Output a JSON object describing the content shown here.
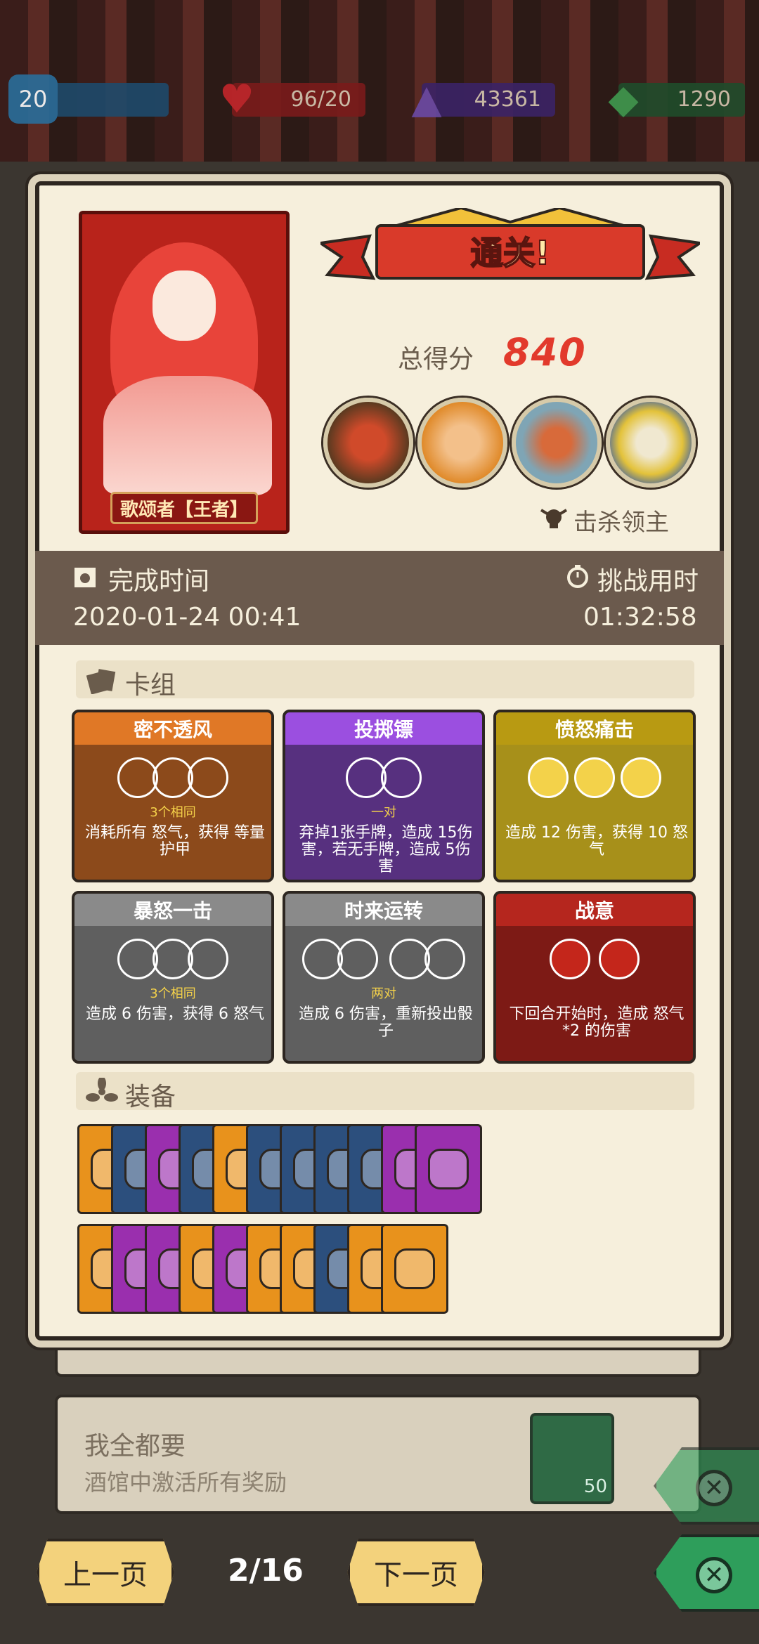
{
  "stats": {
    "level": "20",
    "hp": "96/20",
    "purple": "43361",
    "green": "1290"
  },
  "background_list": [
    {
      "title": "",
      "desc": "",
      "gem_count": "50"
    },
    {
      "title": "我全都要",
      "desc": "酒馆中激活所有奖励",
      "gem_count": "50"
    }
  ],
  "result": {
    "hero_name": "歌颂者【王者】",
    "banner": "通关!",
    "score_label": "总得分",
    "score_value": "840",
    "kill_label": "击杀领主",
    "finish_label": "完成时间",
    "finish_value": "2020-01-24 00:41",
    "duration_label": "挑战用时",
    "duration_value": "01:32:58"
  },
  "deck": {
    "title": "卡组",
    "cards": [
      {
        "name": "密不透风",
        "color": "#e07826",
        "body": "#8c4a1b",
        "sub": "3个相同",
        "desc": "消耗所有  怒气，获得 等量  护甲",
        "dice": "3"
      },
      {
        "name": "投掷镖",
        "color": "#9b4fe0",
        "body": "#57307f",
        "sub": "一对",
        "desc": "弃掉1张手牌，造成  15伤害，若无手牌，造成  5伤害",
        "dice": "2"
      },
      {
        "name": "愤怒痛击",
        "color": "#b89a12",
        "body": "#a7901a",
        "sub": "",
        "desc": "造成  12 伤害，获得  10 怒气",
        "dice": "yellow"
      },
      {
        "name": "暴怒一击",
        "color": "#8a8a8a",
        "body": "#5f5f5f",
        "sub": "3个相同",
        "desc": "造成  6 伤害，获得  6 怒气",
        "dice": "3"
      },
      {
        "name": "时来运转",
        "color": "#8a8a8a",
        "body": "#5f5f5f",
        "sub": "两对",
        "desc": "造成  6 伤害，重新投出骰子",
        "dice": "pairs"
      },
      {
        "name": "战意",
        "color": "#b5261e",
        "body": "#7d1a15",
        "sub": "",
        "desc": "下回合开始时，造成  怒气*2 的伤害",
        "dice": "fire"
      }
    ]
  },
  "equipment": {
    "title": "装备",
    "row1": [
      "helmet-icon",
      "jar-icon",
      "heart-icon",
      "crown-icon",
      "skull-icon",
      "helm-icon",
      "leaf-icon",
      "moon-icon",
      "key-icon",
      "charm-icon",
      "gem-icon"
    ],
    "row1_colors": [
      "#e8921c",
      "#2c4f7d",
      "#9a2fae",
      "#2c4f7d",
      "#e8921c",
      "#2c4f7d",
      "#2c4f7d",
      "#2c4f7d",
      "#2c4f7d",
      "#9a2fae",
      "#9a2fae"
    ],
    "row2": [
      "flower-icon",
      "boot-icon",
      "bird-icon",
      "lion-icon",
      "ruby-icon",
      "crystal-icon",
      "mask-icon",
      "skull2-icon",
      "spike-icon",
      "ring-icon"
    ],
    "row2_colors": [
      "#e8921c",
      "#9a2fae",
      "#9a2fae",
      "#e8921c",
      "#9a2fae",
      "#e8921c",
      "#e8921c",
      "#2c4f7d",
      "#e8921c",
      "#e8921c"
    ]
  },
  "nav": {
    "prev": "上一页",
    "page": "2/16",
    "next": "下一页"
  }
}
